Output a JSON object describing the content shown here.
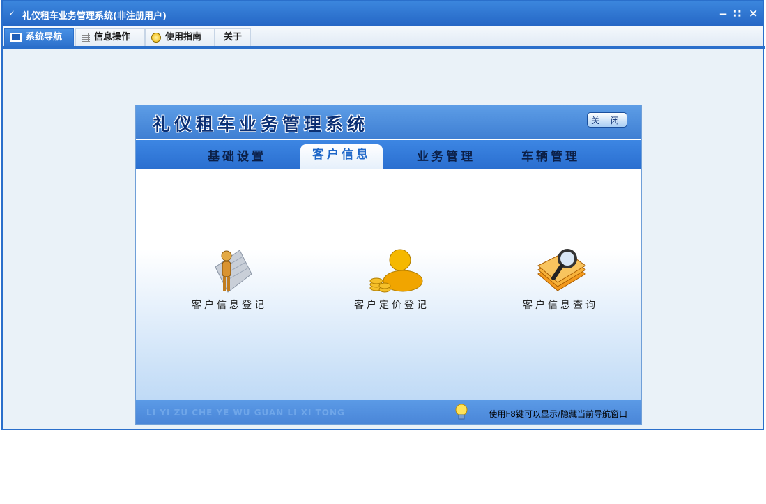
{
  "window": {
    "title": "礼仪租车业务管理系统(非注册用户)"
  },
  "menu": {
    "tabs": [
      {
        "label": "系统导航",
        "icon": "monitor-icon",
        "active": true
      },
      {
        "label": "信息操作",
        "icon": "grid-icon",
        "active": false
      },
      {
        "label": "使用指南",
        "icon": "bulb-icon",
        "active": false
      },
      {
        "label": "关于",
        "icon": "",
        "active": false
      }
    ]
  },
  "panel": {
    "title": "礼仪租车业务管理系统",
    "close_label": "关 闭",
    "tabs": [
      {
        "label": "基础设置"
      },
      {
        "label": "客户信息",
        "active": true
      },
      {
        "label": "业务管理"
      },
      {
        "label": "车辆管理"
      }
    ],
    "features": [
      {
        "label": "客户信息登记",
        "icon": "customer-register-icon"
      },
      {
        "label": "客户定价登记",
        "icon": "customer-pricing-icon"
      },
      {
        "label": "客户信息查询",
        "icon": "customer-search-icon"
      }
    ],
    "footer": {
      "pinyin": "LI YI ZU CHE YE WU GUAN LI XI TONG",
      "hint": "使用F8键可以显示/隐藏当前导航窗口"
    }
  }
}
